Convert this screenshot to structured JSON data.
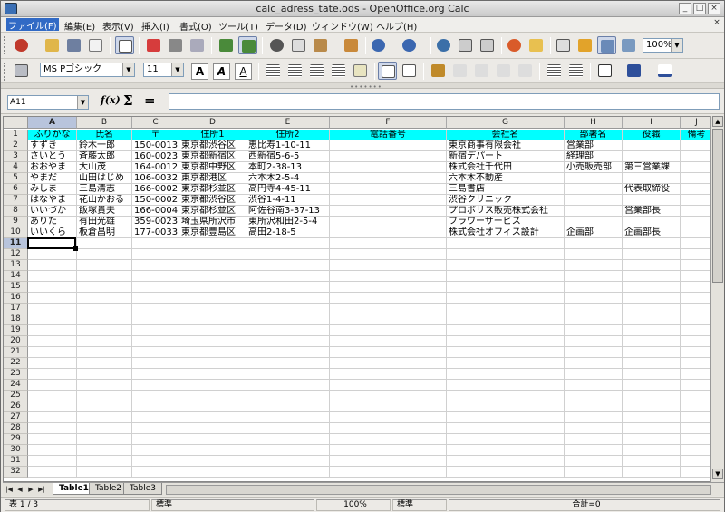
{
  "window": {
    "title": "calc_adress_tate.ods - OpenOffice.org Calc"
  },
  "menu": [
    "ファイル(F)",
    "編集(E)",
    "表示(V)",
    "挿入(I)",
    "書式(O)",
    "ツール(T)",
    "データ(D)",
    "ウィンドウ(W)",
    "ヘルプ(H)"
  ],
  "toolbar": {
    "zoom": "100%"
  },
  "format_bar": {
    "font_name": "MS Pゴシック",
    "font_size": "11",
    "bold": "A",
    "italic": "A",
    "underline": "A"
  },
  "formula_bar": {
    "cell_ref": "A11",
    "fx": "f(x)",
    "sum": "Σ",
    "equals": "=",
    "input": ""
  },
  "sheet": {
    "columns": [
      "A",
      "B",
      "C",
      "D",
      "E",
      "F",
      "G",
      "H",
      "I",
      "J"
    ],
    "selected_column": "A",
    "selected_row": "11",
    "row_numbers": [
      "1",
      "2",
      "3",
      "4",
      "5",
      "6",
      "7",
      "8",
      "9",
      "10",
      "11",
      "12",
      "13",
      "14",
      "15",
      "16",
      "17",
      "18",
      "19",
      "20",
      "21",
      "22",
      "23",
      "24",
      "25",
      "26",
      "27",
      "28",
      "29",
      "30",
      "31",
      "32"
    ],
    "rows": [
      [
        "ふりがな",
        "氏名",
        "〒",
        "住所1",
        "住所2",
        "電話番号",
        "会社名",
        "部署名",
        "役職",
        "備考"
      ],
      [
        "すずき",
        "鈴木一郎",
        "150-0013",
        "東京都渋谷区",
        "恵比寿1-10-11",
        "",
        "東京商事有限会社",
        "営業部",
        "",
        ""
      ],
      [
        "さいとう",
        "斉藤太郎",
        "160-0023",
        "東京都新宿区",
        "西新宿5-6-5",
        "",
        "新宿デパート",
        "経理部",
        "",
        ""
      ],
      [
        "おおやま",
        "大山茂",
        "164-0012",
        "東京都中野区",
        "本町2-38-13",
        "",
        "株式会社千代田",
        "小売販売部",
        "第三営業課",
        ""
      ],
      [
        "やまだ",
        "山田はじめ",
        "106-0032",
        "東京都港区",
        "六本木2-5-4",
        "",
        "六本木不動産",
        "",
        "",
        ""
      ],
      [
        "みしま",
        "三島清志",
        "166-0002",
        "東京都杉並区",
        "高円寺4-45-11",
        "",
        "三島書店",
        "",
        "代表取締役",
        ""
      ],
      [
        "はなやま",
        "花山かおる",
        "150-0002",
        "東京都渋谷区",
        "渋谷1-4-11",
        "",
        "渋谷クリニック",
        "",
        "",
        ""
      ],
      [
        "いいづか",
        "飯塚貴夫",
        "166-0004",
        "東京都杉並区",
        "阿佐谷南3-37-13",
        "",
        "プロボリス販売株式会社",
        "",
        "営業部長",
        ""
      ],
      [
        "ありた",
        "有田光雄",
        "359-0023",
        "埼玉県所沢市",
        "東所沢和田2-5-4",
        "",
        "フラワーサービス",
        "",
        "",
        ""
      ],
      [
        "いいくら",
        "板倉昌明",
        "177-0033",
        "東京都豊島区",
        "高田2-18-5",
        "",
        "株式会社オフィス設計",
        "企画部",
        "企画部長",
        ""
      ]
    ]
  },
  "tabs": [
    "Table1",
    "Table2",
    "Table3"
  ],
  "status": {
    "sheet": "表 1 / 3",
    "style": "標準",
    "zoom": "100%",
    "mode": "標準",
    "sum": "合計=0"
  },
  "colors": {
    "header_fill": "#00ffff",
    "selection": "#b8c4dc"
  }
}
